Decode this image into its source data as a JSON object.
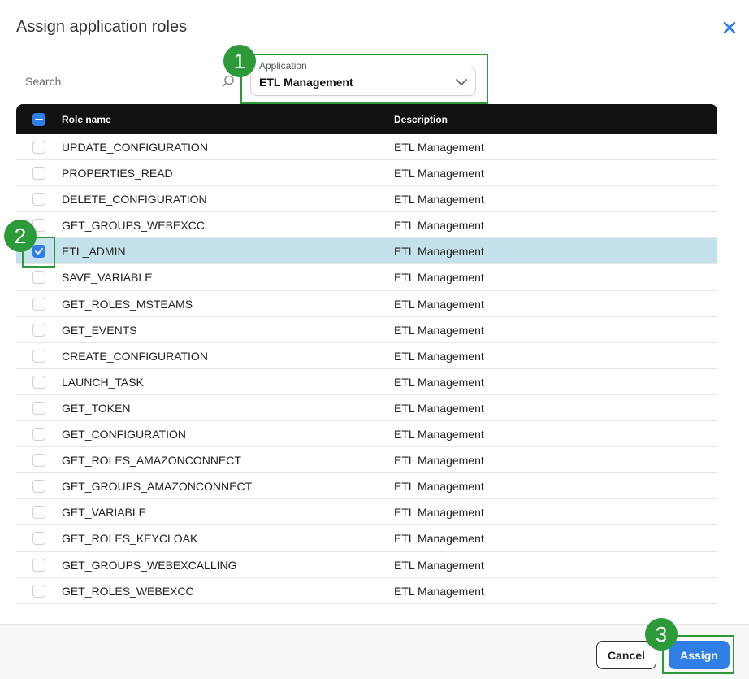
{
  "dialog": {
    "title": "Assign application roles",
    "close_icon": "close-icon"
  },
  "search": {
    "placeholder": "Search",
    "icon": "search-icon"
  },
  "application": {
    "label": "Application",
    "value": "ETL Management",
    "icon": "chevron-down-icon"
  },
  "table": {
    "headers": {
      "name": "Role name",
      "description": "Description"
    },
    "rows": [
      {
        "name": "UPDATE_CONFIGURATION",
        "description": "ETL Management",
        "checked": false
      },
      {
        "name": "PROPERTIES_READ",
        "description": "ETL Management",
        "checked": false
      },
      {
        "name": "DELETE_CONFIGURATION",
        "description": "ETL Management",
        "checked": false
      },
      {
        "name": "GET_GROUPS_WEBEXCC",
        "description": "ETL Management",
        "checked": false
      },
      {
        "name": "ETL_ADMIN",
        "description": "ETL Management",
        "checked": true
      },
      {
        "name": "SAVE_VARIABLE",
        "description": "ETL Management",
        "checked": false
      },
      {
        "name": "GET_ROLES_MSTEAMS",
        "description": "ETL Management",
        "checked": false
      },
      {
        "name": "GET_EVENTS",
        "description": "ETL Management",
        "checked": false
      },
      {
        "name": "CREATE_CONFIGURATION",
        "description": "ETL Management",
        "checked": false
      },
      {
        "name": "LAUNCH_TASK",
        "description": "ETL Management",
        "checked": false
      },
      {
        "name": "GET_TOKEN",
        "description": "ETL Management",
        "checked": false
      },
      {
        "name": "GET_CONFIGURATION",
        "description": "ETL Management",
        "checked": false
      },
      {
        "name": "GET_ROLES_AMAZONCONNECT",
        "description": "ETL Management",
        "checked": false
      },
      {
        "name": "GET_GROUPS_AMAZONCONNECT",
        "description": "ETL Management",
        "checked": false
      },
      {
        "name": "GET_VARIABLE",
        "description": "ETL Management",
        "checked": false
      },
      {
        "name": "GET_ROLES_KEYCLOAK",
        "description": "ETL Management",
        "checked": false
      },
      {
        "name": "GET_GROUPS_WEBEXCALLING",
        "description": "ETL Management",
        "checked": false
      },
      {
        "name": "GET_ROLES_WEBEXCC",
        "description": "ETL Management",
        "checked": false
      }
    ]
  },
  "footer": {
    "cancel_label": "Cancel",
    "assign_label": "Assign"
  },
  "callouts": [
    "1",
    "2",
    "3"
  ],
  "colors": {
    "accent": "#2f7fe6",
    "selected_row": "#c5e1ec",
    "callout": "#2d9a3a",
    "header_bg": "#111111"
  }
}
